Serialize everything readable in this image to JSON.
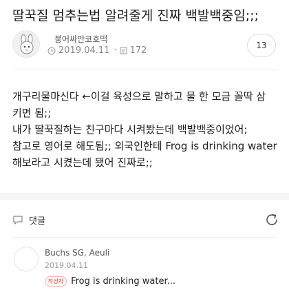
{
  "post": {
    "title": "딸꾹질 멈추는법 알려줄게 진짜 백발백중임;;;",
    "author": "붕어싸만코호떡",
    "date": "2019.04.11",
    "views": "172",
    "comment_count": "13",
    "body": [
      "개구리물마신다 ←이걸 육성으로 말하고 물 한 모금 꼴딱 삼",
      "키면 됨;;",
      "내가 딸꾹질하는 친구마다 시켜봤는데 백발백중이었어;",
      "참고로 영어로 해도됨;; 외국인한테 Frog is drinking water",
      "해보라고 시켰는데 됐어 진짜로;;"
    ]
  },
  "comments": {
    "header_label": "댓글",
    "items": [
      {
        "author": "Buchs SG, Aeuli",
        "date": "2019.04.11",
        "badge": "작성자",
        "text": "Frog is drinking water..."
      }
    ]
  },
  "icons": {
    "clock": "clock-icon",
    "views": "document-icon",
    "comment": "speech-bubble-icon",
    "refresh": "refresh-icon"
  }
}
